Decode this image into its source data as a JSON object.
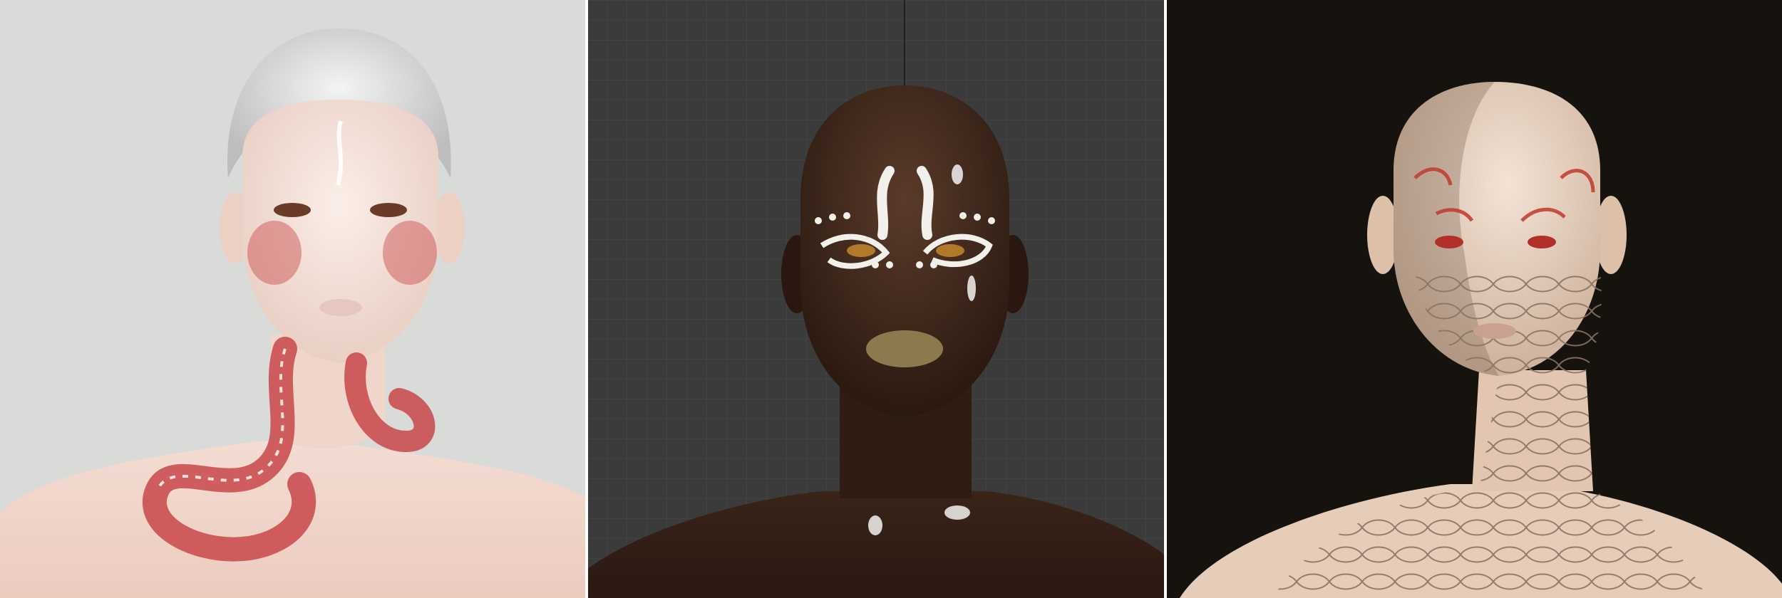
{
  "image": {
    "description_free": true,
    "panels": [
      {
        "id": "left",
        "background": "#d9dbd8",
        "skin": "#f2ddd4",
        "hair": "#dcdcdc",
        "accent": "#c9474a"
      },
      {
        "id": "middle",
        "background": "#3b3b3b",
        "grid": "#4a4a4a",
        "skin": "#3a2419",
        "paint": "#f2f0ea",
        "lips": "#8c7a4e"
      },
      {
        "id": "right",
        "background": "#16130f",
        "skin": "#e9d2bf",
        "accent": "#c0392b",
        "scales": "#8a7361"
      }
    ]
  }
}
